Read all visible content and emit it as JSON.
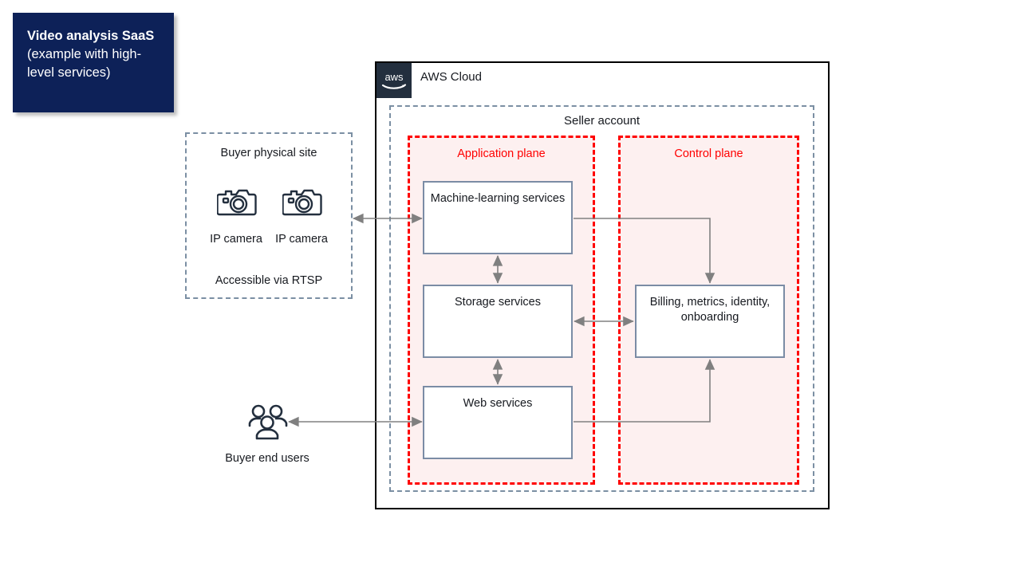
{
  "title_banner": {
    "strong_text": "Video analysis SaaS",
    "rest_text": " (example with high-level services)",
    "background_color": "#0d2158",
    "text_color": "#ffffff"
  },
  "aws_cloud": {
    "label": "AWS Cloud",
    "logo_text": "aws",
    "logo_background": "#232f3e",
    "border_color": "#000000"
  },
  "seller_account": {
    "label": "Seller account",
    "border_style": "dashed",
    "border_color": "#7b8fa3"
  },
  "planes": [
    {
      "id": "application-plane",
      "label": "Application plane",
      "border_color": "#ff0000",
      "fill_color": "#fdf0f0",
      "boxes": [
        {
          "id": "ml-services",
          "label": "Machine-learning services"
        },
        {
          "id": "storage-services",
          "label": "Storage services"
        },
        {
          "id": "web-services",
          "label": "Web services"
        }
      ]
    },
    {
      "id": "control-plane",
      "label": "Control plane",
      "border_color": "#ff0000",
      "fill_color": "#fdf0f0",
      "boxes": [
        {
          "id": "billing",
          "label": "Billing, metrics, identity, onboarding"
        }
      ]
    }
  ],
  "buyer_site": {
    "label": "Buyer physical site",
    "note": "Accessible via RTSP",
    "border_color": "#7b8fa3",
    "devices": [
      {
        "id": "camera-1",
        "icon": "camera-icon",
        "label": "IP camera"
      },
      {
        "id": "camera-2",
        "icon": "camera-icon",
        "label": "IP camera"
      }
    ]
  },
  "buyer_users": {
    "icon": "users-group-icon",
    "label": "Buyer end users"
  },
  "connectors": [
    {
      "id": "cameras-to-ml",
      "from": "buyer-site",
      "to": "ml-services",
      "direction": "bidirectional"
    },
    {
      "id": "ml-to-storage",
      "from": "ml-services",
      "to": "storage-services",
      "direction": "bidirectional"
    },
    {
      "id": "storage-to-web",
      "from": "storage-services",
      "to": "web-services",
      "direction": "bidirectional"
    },
    {
      "id": "storage-to-billing",
      "from": "storage-services",
      "to": "billing",
      "direction": "bidirectional"
    },
    {
      "id": "ml-to-billing",
      "from": "ml-services",
      "to": "billing",
      "direction": "unidirectional"
    },
    {
      "id": "web-to-billing",
      "from": "web-services",
      "to": "billing",
      "direction": "unidirectional"
    },
    {
      "id": "users-to-web",
      "from": "buyer-users",
      "to": "web-services",
      "direction": "bidirectional"
    }
  ],
  "colors": {
    "icon_stroke": "#232f3e",
    "connector": "#808080",
    "box_border": "#7b8ca5",
    "text": "#16191f"
  }
}
